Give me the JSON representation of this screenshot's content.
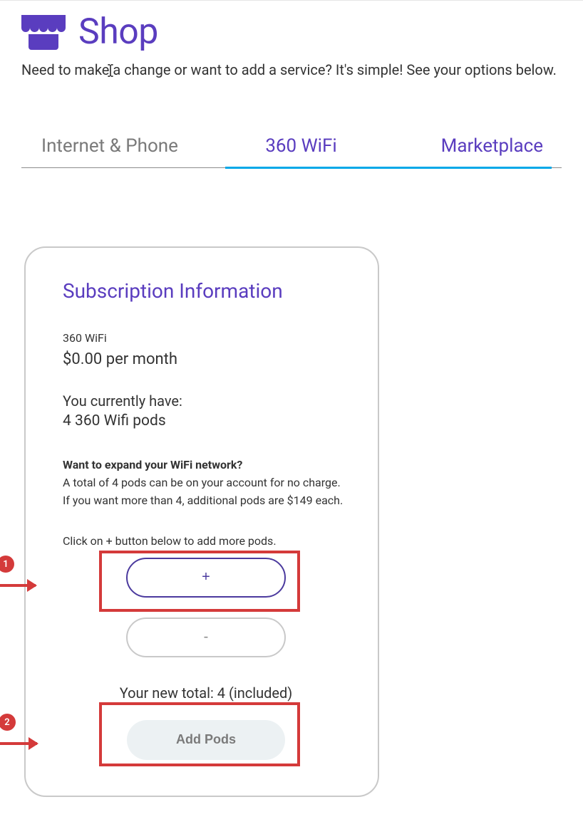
{
  "header": {
    "title": "Shop",
    "subtitle": "Need to make a change or want to add a service? It's simple! See your options below."
  },
  "tabs": {
    "internet": "Internet & Phone",
    "wifi": "360 WiFi",
    "marketplace": "Marketplace"
  },
  "card": {
    "title": "Subscription Information",
    "product": "360 WiFi",
    "price": "$0.00 per month",
    "current_label": "You currently have:",
    "current_count": "4 360 Wifi pods",
    "expand_title": "Want to expand your WiFi network?",
    "expand_desc": "A total of 4 pods can be on your account for no charge. If you want more than 4, additional pods are $149 each.",
    "instruction": "Click on + button below to add more pods.",
    "plus_label": "+",
    "minus_label": "-",
    "total_line": "Your new total: 4 (included)",
    "add_pods_label": "Add Pods"
  },
  "annotations": {
    "step1": "1",
    "step2": "2"
  }
}
